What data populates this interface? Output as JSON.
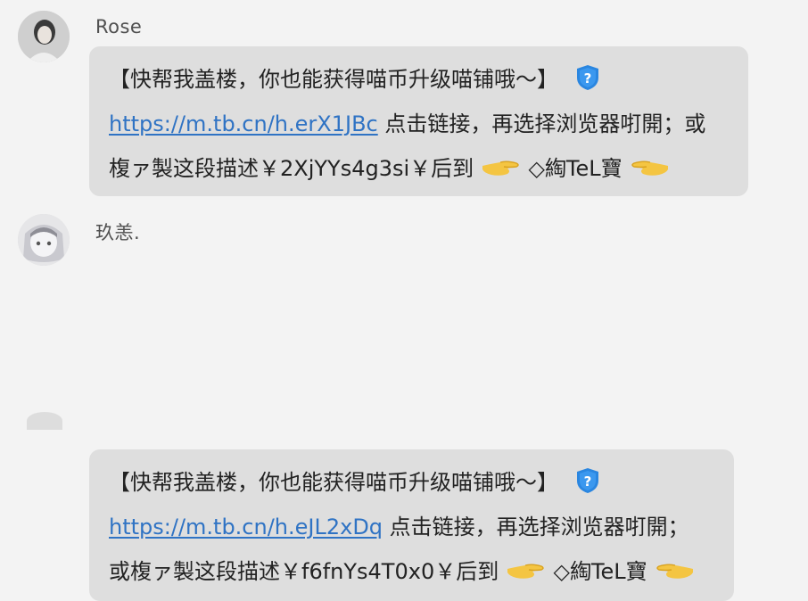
{
  "messages": [
    {
      "sender": "Rose",
      "line1_text": "【快帮我盖楼，你也能获得喵币升级喵铺哦～】",
      "line2_link": "https://m.tb.cn/h.erX1JBc",
      "line2_text": " 点击链接，再选择浏览器咑開；或",
      "line3_text_a": "椱ァ製这段描述￥2XjYYs4g3si￥后到",
      "line3_text_b": "◇綯TeL寶"
    },
    {
      "sender": "玖恙.",
      "line1_text": "【快帮我盖楼，你也能获得喵币升级喵铺哦～】",
      "line2_link": "https://m.tb.cn/h.eJL2xDq",
      "line2_text": " 点击链接，再选择浏览器咑開；",
      "line3_text_a": "或椱ァ製这段描述￥f6fnYs4T0x0￥后到",
      "line3_text_b": "◇綯TeL寶"
    }
  ],
  "icons": {
    "help_badge": "question-shield-icon",
    "pointing_hand": "pointing-hand-icon"
  },
  "colors": {
    "background": "#f3f3f3",
    "bubble": "#dedede",
    "link": "#2f73c4",
    "badge": "#2a86e0"
  }
}
